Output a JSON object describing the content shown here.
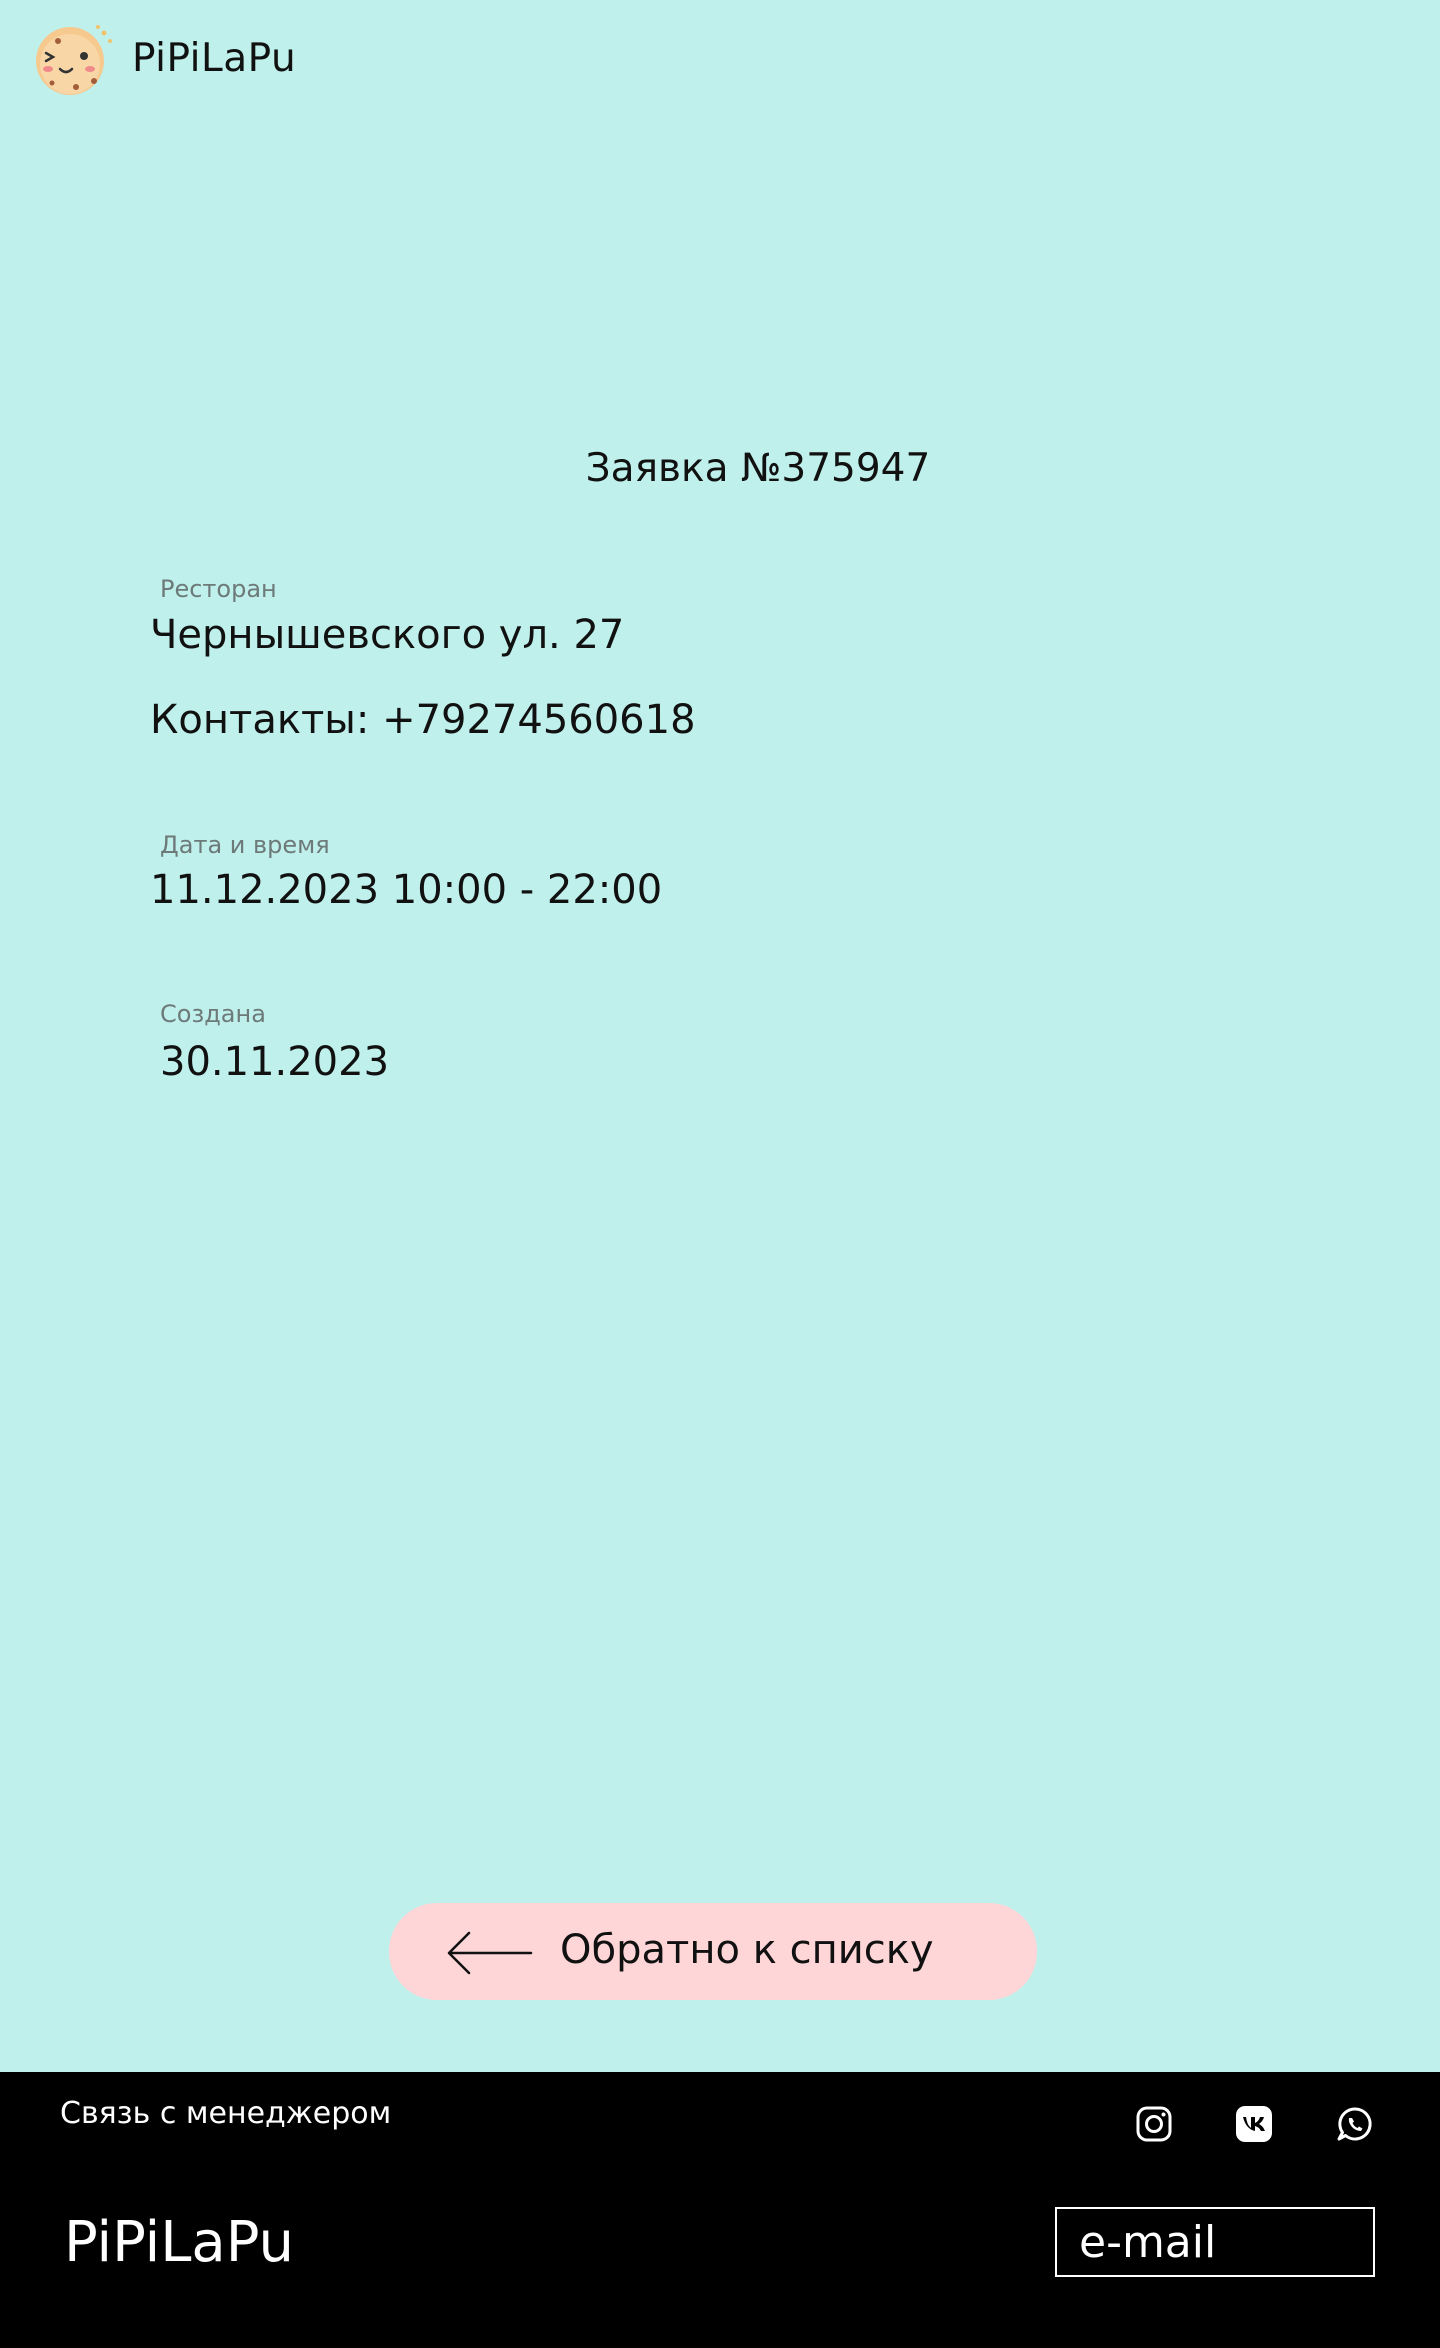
{
  "header": {
    "brand": "PiPiLaPu",
    "logo_icon": "cookie-icon"
  },
  "order": {
    "title": "Заявка №375947",
    "restaurant_label": "Ресторан",
    "restaurant_value": "Чернышевского ул. 27",
    "contacts": "Контакты: +79274560618",
    "datetime_label": "Дата и время",
    "datetime_value": "11.12.2023 10:00 - 22:00",
    "created_label": "Создана",
    "created_value": "30.11.2023"
  },
  "back_button": {
    "label": "Обратно к списку",
    "icon": "arrow-left-icon"
  },
  "footer": {
    "contact": "Связь с менеджером",
    "brand": "PiPiLaPu",
    "email_placeholder": "e-mail",
    "social": [
      "instagram-icon",
      "vk-icon",
      "whatsapp-icon"
    ]
  },
  "colors": {
    "background": "#bff0eb",
    "button": "#ffd6d8",
    "footer": "#000000"
  }
}
